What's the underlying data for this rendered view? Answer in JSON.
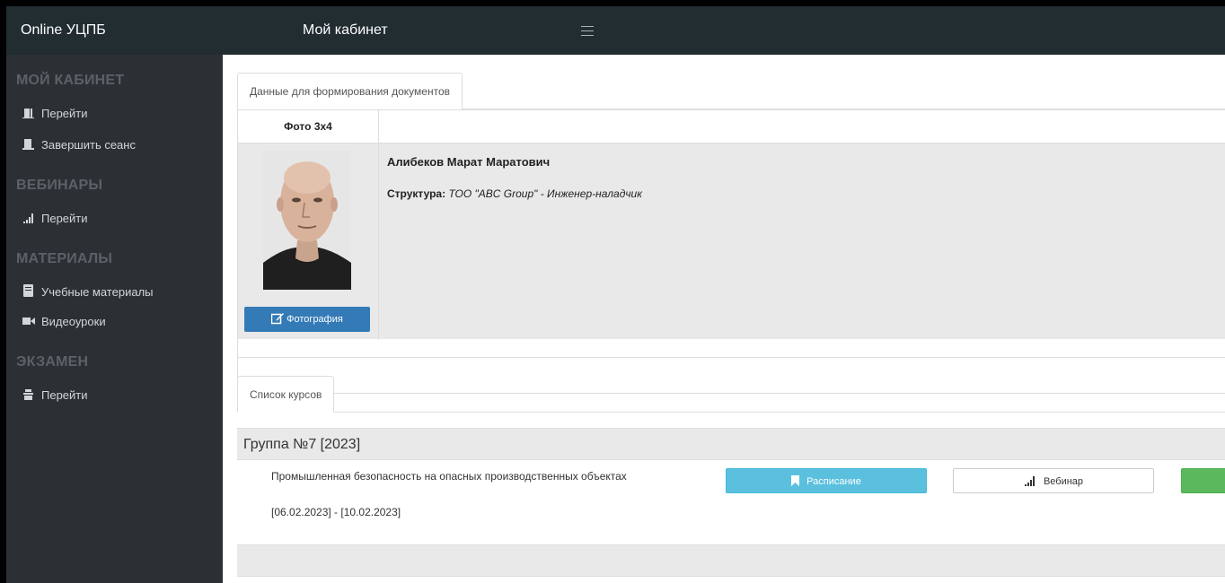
{
  "navbar": {
    "brand": "Online УЦПБ",
    "page_title": "Мой кабинет"
  },
  "sidebar": {
    "sections": [
      {
        "title": "МОЙ КАБИНЕТ",
        "items": [
          {
            "label": "Перейти",
            "icon": "door-icon"
          },
          {
            "label": "Завершить сеанс",
            "icon": "logout-icon"
          }
        ]
      },
      {
        "title": "ВЕБИНАРЫ",
        "items": [
          {
            "label": "Перейти",
            "icon": "signal-icon"
          }
        ]
      },
      {
        "title": "МАТЕРИАЛЫ",
        "items": [
          {
            "label": "Учебные материалы",
            "icon": "book-icon"
          },
          {
            "label": "Видеоуроки",
            "icon": "video-camera-icon"
          }
        ]
      },
      {
        "title": "ЭКЗАМЕН",
        "items": [
          {
            "label": "Перейти",
            "icon": "exam-icon"
          }
        ]
      }
    ]
  },
  "documents": {
    "tab_label": "Данные для формирования документов",
    "photo_header": "Фото 3x4",
    "photo_button": "Фотография",
    "person_name": "Алибеков Марат Маратович",
    "structure_label": "Структура:",
    "structure_value": "ТОО \"ABC Group\" - Инженер-наладчик"
  },
  "courses": {
    "tab_label": "Список курсов",
    "group_title": "Группа №7 [2023]",
    "course_name": "Промышленная безопасность на опасных производственных объектах",
    "course_dates": "[06.02.2023] - [10.02.2023]",
    "schedule_button": "Расписание",
    "webinar_button": "Вебинар"
  },
  "colors": {
    "navbar_bg": "#222d32",
    "sidebar_bg": "#2c3034",
    "primary": "#337ab7",
    "info": "#5bc0de",
    "success": "#5cb85c"
  }
}
